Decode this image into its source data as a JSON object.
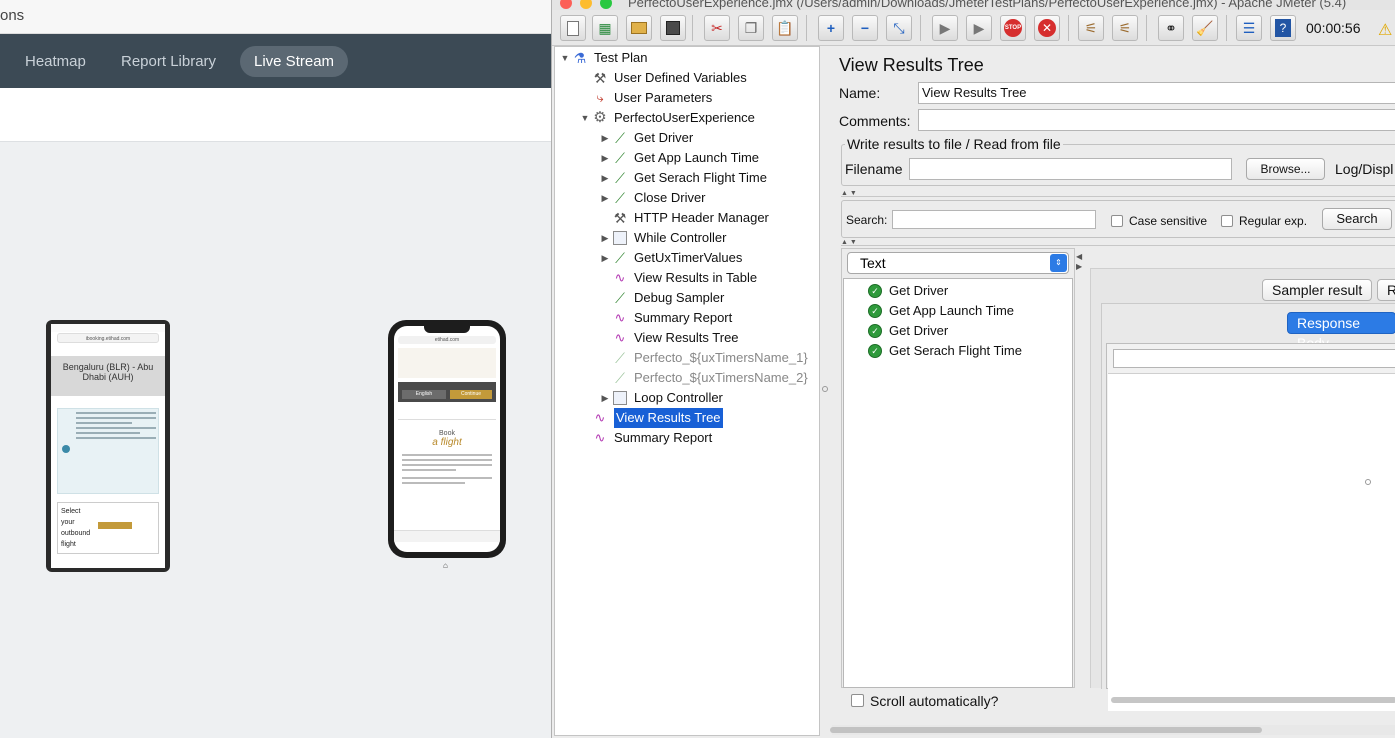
{
  "webapp": {
    "topstrip_text": "ons",
    "nav": [
      {
        "label": "Heatmap"
      },
      {
        "label": "Report Library"
      },
      {
        "label": "Live Stream"
      }
    ],
    "android_screen": {
      "header": "Bengaluru (BLR) - Abu Dhabi (AUH)",
      "url": "ibooking.etihad.com",
      "select_text": "Select your outbound flight"
    },
    "iphone_screen": {
      "url": "etihad.com",
      "book_text": "Book",
      "flight_text": "a flight",
      "language_left": "English",
      "language_right": "Continue"
    }
  },
  "jmeter": {
    "window_title": "PerfectoUserExperience.jmx (/Users/admin/Downloads/JmeterTestPlans/PerfectoUserExperience.jmx) - Apache JMeter (5.4)",
    "elapsed_time": "00:00:56",
    "toolbar_icons": [
      "new-icon",
      "templates-icon",
      "open-icon",
      "save-icon",
      "cut-icon",
      "copy-icon",
      "paste-icon",
      "expand-icon",
      "collapse-icon",
      "toggle-icon",
      "start-icon",
      "start-no-pauses-icon",
      "stop-icon",
      "shutdown-icon",
      "clear-icon",
      "clear-all-icon",
      "search-icon",
      "reset-search-icon",
      "function-helper-icon",
      "help-icon"
    ],
    "tree": [
      {
        "label": "Test Plan",
        "icon": "flask-icon",
        "level": 0,
        "expander": "open"
      },
      {
        "label": "User Defined Variables",
        "icon": "tools-icon",
        "level": 1,
        "expander": "none"
      },
      {
        "label": "User Parameters",
        "icon": "preprocessor-icon",
        "level": 1,
        "expander": "none"
      },
      {
        "label": "PerfectoUserExperience",
        "icon": "gear-icon",
        "level": 1,
        "expander": "open"
      },
      {
        "label": "Get Driver",
        "icon": "pipette-icon",
        "level": 2,
        "expander": "closed"
      },
      {
        "label": "Get App Launch Time",
        "icon": "pipette-icon",
        "level": 2,
        "expander": "closed"
      },
      {
        "label": "Get Serach Flight Time",
        "icon": "pipette-icon",
        "level": 2,
        "expander": "closed"
      },
      {
        "label": "Close Driver",
        "icon": "pipette-icon",
        "level": 2,
        "expander": "closed"
      },
      {
        "label": "HTTP Header Manager",
        "icon": "tools-icon",
        "level": 2,
        "expander": "none"
      },
      {
        "label": "While Controller",
        "icon": "controller-icon",
        "level": 2,
        "expander": "closed"
      },
      {
        "label": "GetUxTimerValues",
        "icon": "pipette-icon",
        "level": 2,
        "expander": "closed"
      },
      {
        "label": "View Results in Table",
        "icon": "listener-icon",
        "level": 2,
        "expander": "none"
      },
      {
        "label": "Debug Sampler",
        "icon": "pipette-icon",
        "level": 2,
        "expander": "none"
      },
      {
        "label": "Summary Report",
        "icon": "listener-icon",
        "level": 2,
        "expander": "none"
      },
      {
        "label": "View Results Tree",
        "icon": "listener-icon",
        "level": 2,
        "expander": "none"
      },
      {
        "label": "Perfecto_${uxTimersName_1}",
        "icon": "pipette-icon",
        "level": 2,
        "expander": "none",
        "disabled": true
      },
      {
        "label": "Perfecto_${uxTimersName_2}",
        "icon": "pipette-icon",
        "level": 2,
        "expander": "none",
        "disabled": true
      },
      {
        "label": "Loop Controller",
        "icon": "controller-icon",
        "level": 2,
        "expander": "closed"
      },
      {
        "label": "View Results Tree",
        "icon": "listener-icon",
        "level": 1,
        "expander": "none",
        "selected": true
      },
      {
        "label": "Summary Report",
        "icon": "listener-icon",
        "level": 1,
        "expander": "none"
      }
    ],
    "panel": {
      "title": "View Results Tree",
      "name_label": "Name:",
      "name_value": "View Results Tree",
      "comments_label": "Comments:",
      "comments_value": "",
      "file_legend": "Write results to file / Read from file",
      "filename_label": "Filename",
      "filename_value": "",
      "browse_label": "Browse...",
      "logdisplay_label": "Log/Displ",
      "search_label": "Search:",
      "search_value": "",
      "case_sensitive_label": "Case sensitive",
      "regex_label": "Regular exp.",
      "search_button": "Search",
      "renderer_selected": "Text",
      "results": [
        "Get Driver",
        "Get App Launch Time",
        "Get Driver",
        "Get Serach Flight Time"
      ],
      "tab_sampler": "Sampler result",
      "tab_request": "Re",
      "tab_response_body": "Response Body",
      "scroll_auto_label": "Scroll automatically?"
    }
  }
}
